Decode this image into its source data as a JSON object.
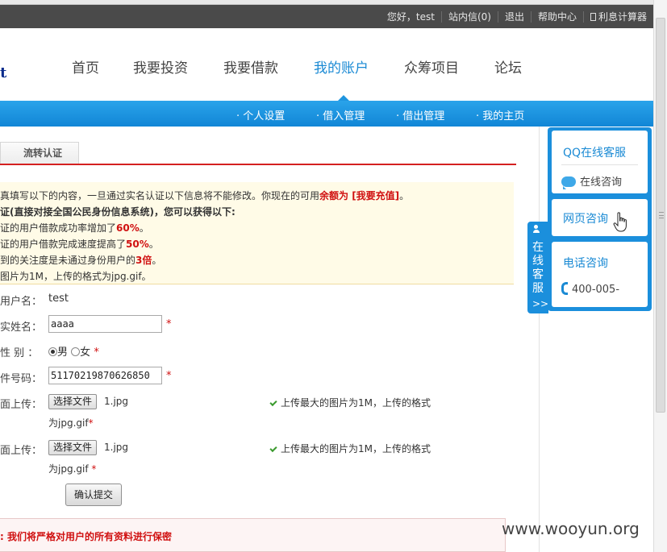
{
  "topbar": {
    "greeting": "您好，test",
    "inbox": "站内信(0)",
    "logout": "退出",
    "help": "帮助中心",
    "calculator": "利息计算器"
  },
  "logo": {
    "fragment": "t"
  },
  "nav": {
    "items": [
      "首页",
      "我要投资",
      "我要借款",
      "我的账户",
      "众筹项目",
      "论坛"
    ],
    "active": "我的账户"
  },
  "subnav": {
    "items": [
      "· 个人设置",
      "· 借入管理",
      "· 借出管理",
      "· 我的主页"
    ]
  },
  "tab": {
    "label": "流转认证"
  },
  "notice": {
    "line1_prefix": "真填写以下的内容，一旦通过实名认证以下信息将不能修改。你现在的可用",
    "line1_red": "余额为 [我要充值]",
    "line1_suffix": "。",
    "line2": "证(直接对接全国公民身份信息系统)，您可以获得以下:",
    "line3_prefix": "证的用户借款成功率增加了",
    "line3_value": "60%",
    "line3_suffix": "。",
    "line4_prefix": "证的用户借款完成速度提高了",
    "line4_value": "50%",
    "line4_suffix": "。",
    "line5_prefix": "到的关注度是未通过身份用户的",
    "line5_value": "3倍",
    "line5_suffix": "。",
    "line6": "图片为1M，上传的格式为jpg.gif。"
  },
  "form": {
    "username_label": "用户名：",
    "username_value": "test",
    "realname_label": "实姓名：",
    "realname_value": "aaaa",
    "gender_label": "性 别 ：",
    "gender_male": "男",
    "gender_female": "女",
    "idnum_label": "件号码：",
    "idnum_value": "51170219870626850",
    "required": "*",
    "upload1_label": "面上传：",
    "upload2_label": "面上传：",
    "choose_file": "选择文件",
    "file1": "1.jpg",
    "file2": "1.jpg",
    "hint": "上传最大的图片为1M，上传的格式",
    "hint_cont1": "为jpg.gif",
    "hint_cont2": "为jpg.gif",
    "submit": "确认提交"
  },
  "bottom": {
    "privacy": ": 我们将严格对用户的所有资料进行保密"
  },
  "service": {
    "tab_label": "在线客服",
    "tab_arrow": ">>",
    "qq_title": "QQ在线客服",
    "qq_action": "在线咨询",
    "web_title": "网页咨询",
    "phone_title": "电话咨询",
    "phone_number": "400-005-"
  },
  "watermark": "www.wooyun.org"
}
